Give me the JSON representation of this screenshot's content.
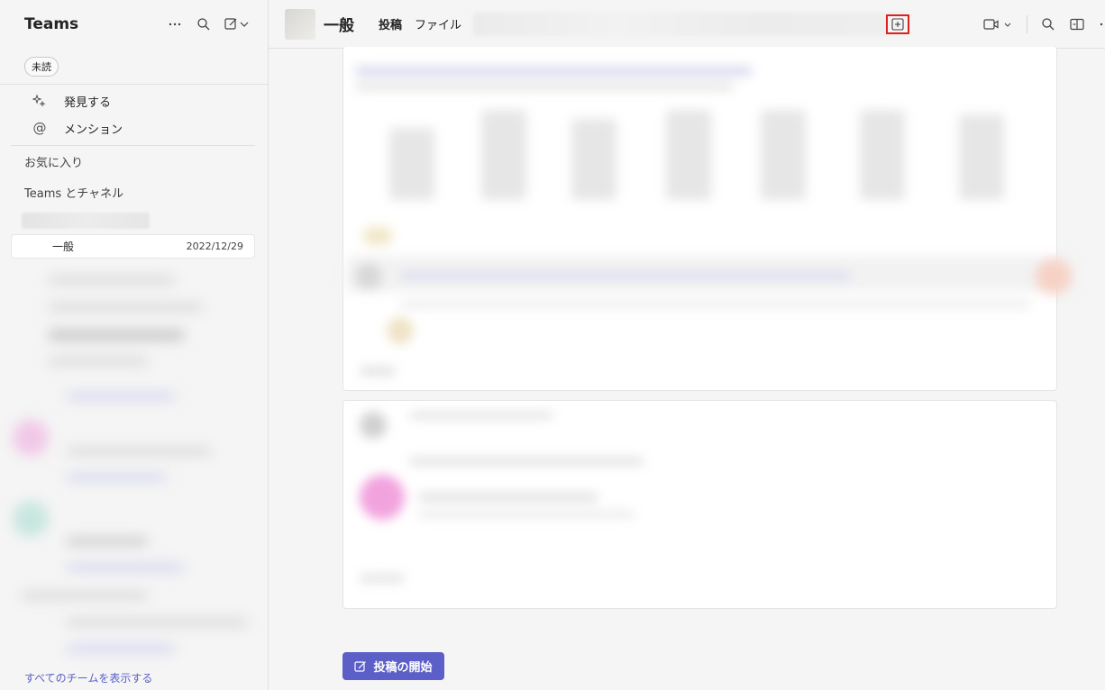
{
  "sidebar": {
    "title": "Teams",
    "filter_chip": "未読",
    "nav": [
      {
        "icon": "sparkle-icon",
        "label": "発見する"
      },
      {
        "icon": "at-icon",
        "label": "メンション"
      }
    ],
    "sections": {
      "favorites": "お気に入り",
      "teams_channels": "Teams とチャネル"
    },
    "selected_channel": {
      "name": "一般",
      "date": "2022/12/29"
    },
    "footer_link": "すべてのチームを表示する"
  },
  "header": {
    "channel_name": "一般",
    "tabs": [
      "投稿",
      "ファイル"
    ],
    "active_tab": "投稿"
  },
  "compose": {
    "button_label": "投稿の開始"
  },
  "colors": {
    "accent": "#5b5fc7",
    "highlight_box": "#e0201c"
  }
}
